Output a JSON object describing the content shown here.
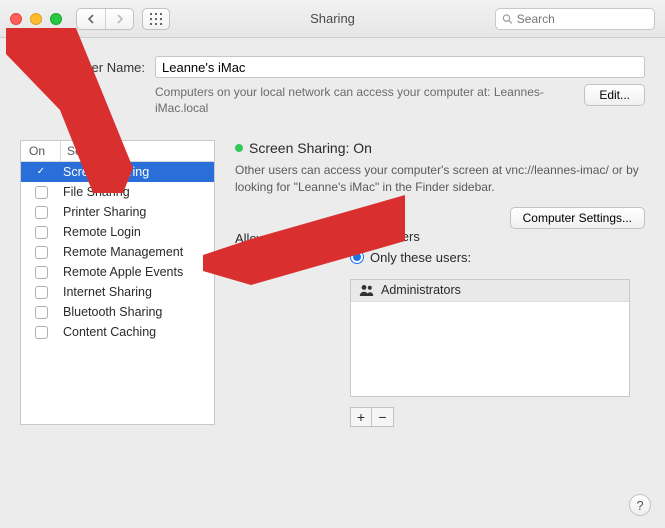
{
  "window": {
    "title": "Sharing",
    "search_placeholder": "Search"
  },
  "computer": {
    "label": "Computer Name:",
    "name": "Leanne's iMac",
    "hint": "Computers on your local network can access your computer at: Leannes-iMac.local",
    "edit_label": "Edit..."
  },
  "services": {
    "head_on": "On",
    "head_service": "Service",
    "items": [
      {
        "label": "Screen Sharing",
        "checked": true,
        "selected": true
      },
      {
        "label": "File Sharing",
        "checked": false,
        "selected": false
      },
      {
        "label": "Printer Sharing",
        "checked": false,
        "selected": false
      },
      {
        "label": "Remote Login",
        "checked": false,
        "selected": false
      },
      {
        "label": "Remote Management",
        "checked": false,
        "selected": false
      },
      {
        "label": "Remote Apple Events",
        "checked": false,
        "selected": false
      },
      {
        "label": "Internet Sharing",
        "checked": false,
        "selected": false
      },
      {
        "label": "Bluetooth Sharing",
        "checked": false,
        "selected": false
      },
      {
        "label": "Content Caching",
        "checked": false,
        "selected": false
      }
    ]
  },
  "detail": {
    "status_label": "Screen Sharing: On",
    "description": "Other users can access your computer's screen at vnc://leannes-imac/ or by looking for \"Leanne's iMac\" in the Finder sidebar.",
    "computer_settings_label": "Computer Settings...",
    "allow_label": "Allow access for:",
    "radio_all": "All users",
    "radio_only": "Only these users:",
    "selected_radio": "only",
    "users": [
      {
        "label": "Administrators"
      }
    ],
    "plus": "+",
    "minus": "−"
  },
  "help": {
    "label": "?"
  }
}
